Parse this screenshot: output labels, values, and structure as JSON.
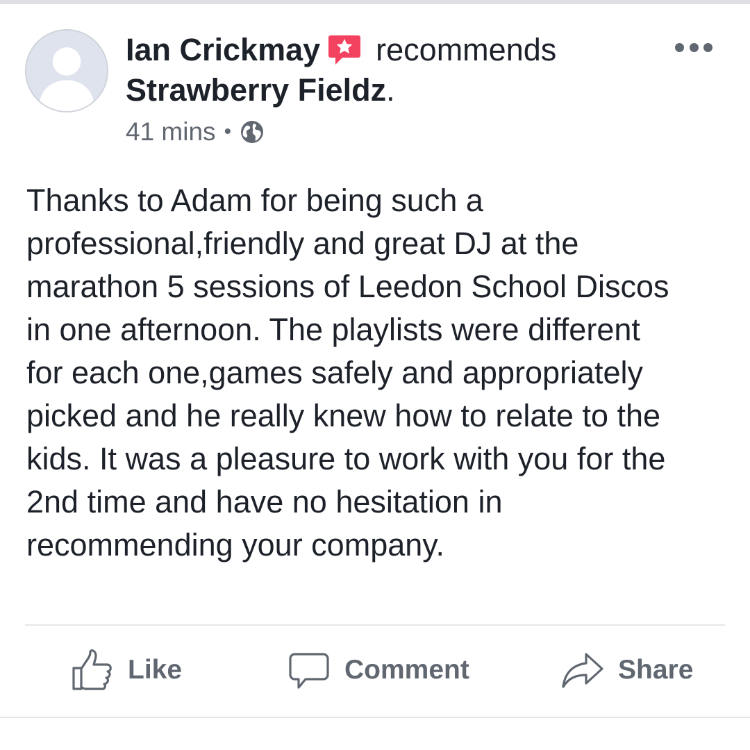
{
  "post": {
    "author": "Ian Crickmay",
    "verb": "recommends",
    "page_name": "Strawberry Fieldz",
    "period": ".",
    "timestamp": "41 mins",
    "separator": "•",
    "privacy_icon": "globe-icon",
    "recommend_icon": "recommendation-star-icon",
    "more_icon": "more-options-icon",
    "body_lines": [
      "Thanks to Adam for being such a",
      "professional,friendly and great DJ at the",
      "marathon 5 sessions of Leedon School Discos",
      "in one afternoon. The playlists were different",
      "for each one,games safely and appropriately",
      "picked and he really knew how to relate to the",
      "kids. It was a pleasure to work with you for the",
      "2nd time and have no hesitation in",
      "recommending your company."
    ]
  },
  "actions": {
    "like_label": "Like",
    "comment_label": "Comment",
    "share_label": "Share"
  },
  "colors": {
    "text": "#1d2129",
    "secondary": "#606770",
    "recommend_accent": "#f3425f",
    "divider": "#e5e6e9"
  }
}
